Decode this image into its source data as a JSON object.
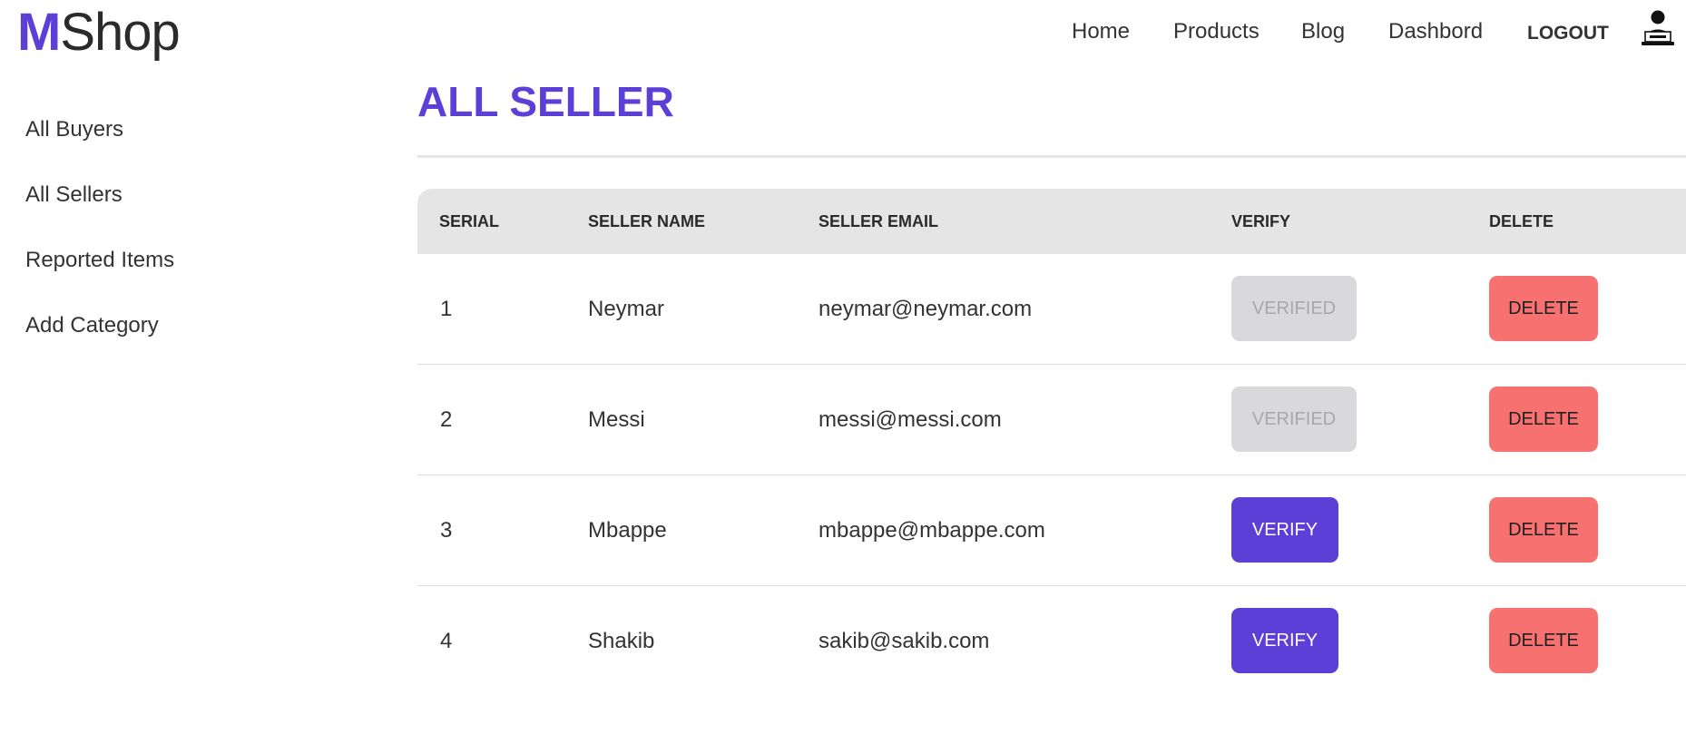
{
  "brand": {
    "first_letter": "M",
    "rest": "Shop",
    "accent_color": "#5c3fd6"
  },
  "nav": {
    "links": [
      "Home",
      "Products",
      "Blog",
      "Dashbord"
    ],
    "logout_label": "LOGOUT",
    "avatar_icon": "admin-avatar-icon"
  },
  "sidebar": {
    "items": [
      "All Buyers",
      "All Sellers",
      "Reported Items",
      "Add Category"
    ]
  },
  "main": {
    "title": "ALL SELLER",
    "table": {
      "headers": [
        "SERIAL",
        "SELLER NAME",
        "SELLER EMAIL",
        "VERIFY",
        "DELETE"
      ],
      "rows": [
        {
          "serial": "1",
          "name": "Neymar",
          "email": "neymar@neymar.com",
          "verify_label": "VERIFIED",
          "verified": true,
          "delete_label": "DELETE"
        },
        {
          "serial": "2",
          "name": "Messi",
          "email": "messi@messi.com",
          "verify_label": "VERIFIED",
          "verified": true,
          "delete_label": "DELETE"
        },
        {
          "serial": "3",
          "name": "Mbappe",
          "email": "mbappe@mbappe.com",
          "verify_label": "VERIFY",
          "verified": false,
          "delete_label": "DELETE"
        },
        {
          "serial": "4",
          "name": "Shakib",
          "email": "sakib@sakib.com",
          "verify_label": "VERIFY",
          "verified": false,
          "delete_label": "DELETE"
        }
      ]
    }
  },
  "colors": {
    "verify": "#5c3fd6",
    "verified": "#d9d9db",
    "delete": "#f87171",
    "header_bg": "#e5e5e5"
  }
}
